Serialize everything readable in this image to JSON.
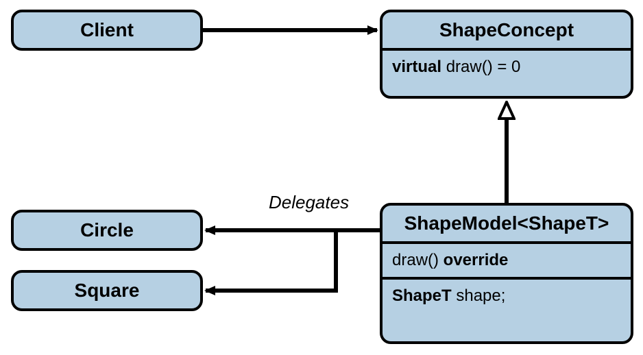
{
  "nodes": {
    "client": {
      "title": "Client"
    },
    "shapeConcept": {
      "title": "ShapeConcept",
      "method_keyword": "virtual",
      "method_rest": " draw() = 0"
    },
    "circle": {
      "title": "Circle"
    },
    "square": {
      "title": "Square"
    },
    "shapeModel": {
      "title": "ShapeModel<ShapeT>",
      "method1_name": "draw() ",
      "method1_keyword": "override",
      "field_type": "ShapeT",
      "field_name": " shape;"
    }
  },
  "labels": {
    "delegates": "Delegates"
  }
}
